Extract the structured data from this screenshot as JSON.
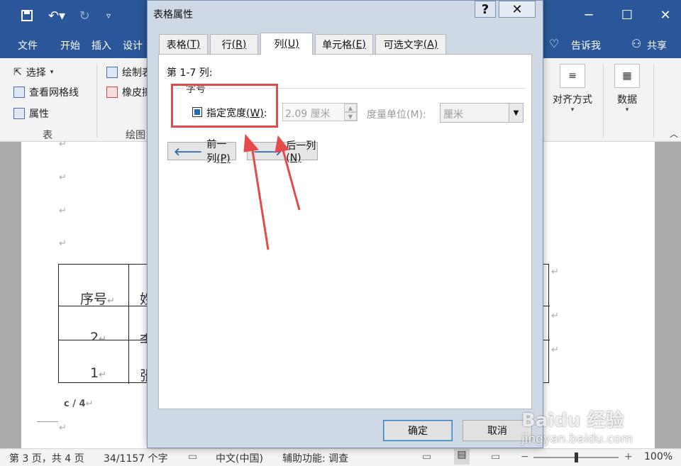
{
  "word": {
    "tabs": [
      "文件",
      "开始",
      "插入",
      "设计"
    ],
    "tell_me": "告诉我",
    "share": "共享",
    "ribbon": {
      "select": "选择",
      "view_gridlines": "查看网格线",
      "properties": "属性",
      "table_group": "表",
      "draw_table": "绘制表",
      "eraser": "橡皮擦",
      "draw_group": "绘图",
      "alignment": "对齐方式",
      "data": "数据"
    }
  },
  "document": {
    "table": {
      "header_1": "序号",
      "header_2": "姓",
      "row1_num": "2",
      "row1_name": "李",
      "row2_num": "1",
      "row2_name": "张"
    },
    "page_footer": "c / 4"
  },
  "status": {
    "page": "第 3 页，共 4 页",
    "words": "34/1157 个字",
    "language": "中文(中国)",
    "accessibility": "辅助功能: 调查",
    "zoom": "100%"
  },
  "dialog": {
    "title": "表格属性",
    "tabs": [
      {
        "label": "表格",
        "key": "(T)"
      },
      {
        "label": "行",
        "key": "(R)"
      },
      {
        "label": "列",
        "key": "(U)"
      },
      {
        "label": "单元格",
        "key": "(E)"
      },
      {
        "label": "可选文字",
        "key": "(A)"
      }
    ],
    "column_heading": "第 1-7 列:",
    "size_group": "字号",
    "preferred_width_label": "指定宽度",
    "preferred_width_key": "(W)",
    "preferred_width_colon": ":",
    "width_value": "2.09 厘米",
    "measure_label": "度量单位(M):",
    "measure_value": "厘米",
    "prev_column": "前一列",
    "prev_key": "(P)",
    "next_column": "后一列",
    "next_key": "(N)",
    "ok": "确定",
    "cancel": "取消"
  },
  "watermark": {
    "site": "Baidu 经验",
    "url": "jingyan.baidu.com"
  },
  "colors": {
    "title_bar": "#2b579a",
    "annotation": "#e34b4b",
    "dialog_frame": "#cfd9e6"
  }
}
